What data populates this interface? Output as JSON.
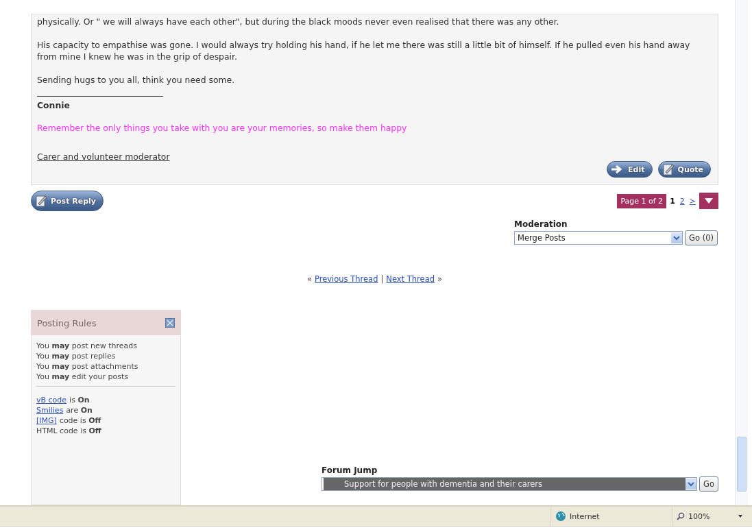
{
  "post": {
    "paragraphs": [
      "physically. Or \" we will always have each other\", but during the black moods never even realised that there was any other.",
      "His capacity to empathise was gone. I would always try holding his hand, if he let me there was still a little bit of himself. If he pulled even his hand away from mine I knew he was in the grip of despair.",
      "Sending hugs to you all, think you need some."
    ],
    "signature": {
      "name": "Connie",
      "motto": "Remember the only things you take with you are your memories, so make them happy",
      "role": "Carer and volunteer moderator"
    },
    "buttons": [
      "Edit",
      "Quote"
    ]
  },
  "post_reply": "Post Reply",
  "pagination": {
    "label": "Page 1 of 2",
    "pages": [
      {
        "label": "1",
        "selected": true
      },
      {
        "label": "2",
        "selected": false
      }
    ],
    "next": ">"
  },
  "moderation": {
    "label": "Moderation",
    "value": "Merge Posts",
    "button": "Go (0)"
  },
  "thread_nav": {
    "prev_arrow": "«",
    "previous": "Previous Thread",
    "separator": "|",
    "next": "Next Thread",
    "next_arrow": "»"
  },
  "posting_rules": {
    "title": "Posting Rules",
    "rules": [
      "You **may** post new threads",
      "You **may** post replies",
      "You **may** post attachments",
      "You **may** edit your posts"
    ],
    "codes": [
      {
        "link": "vB code",
        "text": "is **On**"
      },
      {
        "link": "Smilies",
        "text": "are **On**"
      },
      {
        "link": "[IMG]",
        "text": "code is **Off**"
      },
      {
        "text": "HTML code is **Off**"
      }
    ]
  },
  "forum_jump": {
    "label": "Forum Jump",
    "value": "Support for people with dementia and their carers",
    "button": "Go"
  },
  "status_bar": {
    "zone": "Internet",
    "zoom": "100%"
  }
}
